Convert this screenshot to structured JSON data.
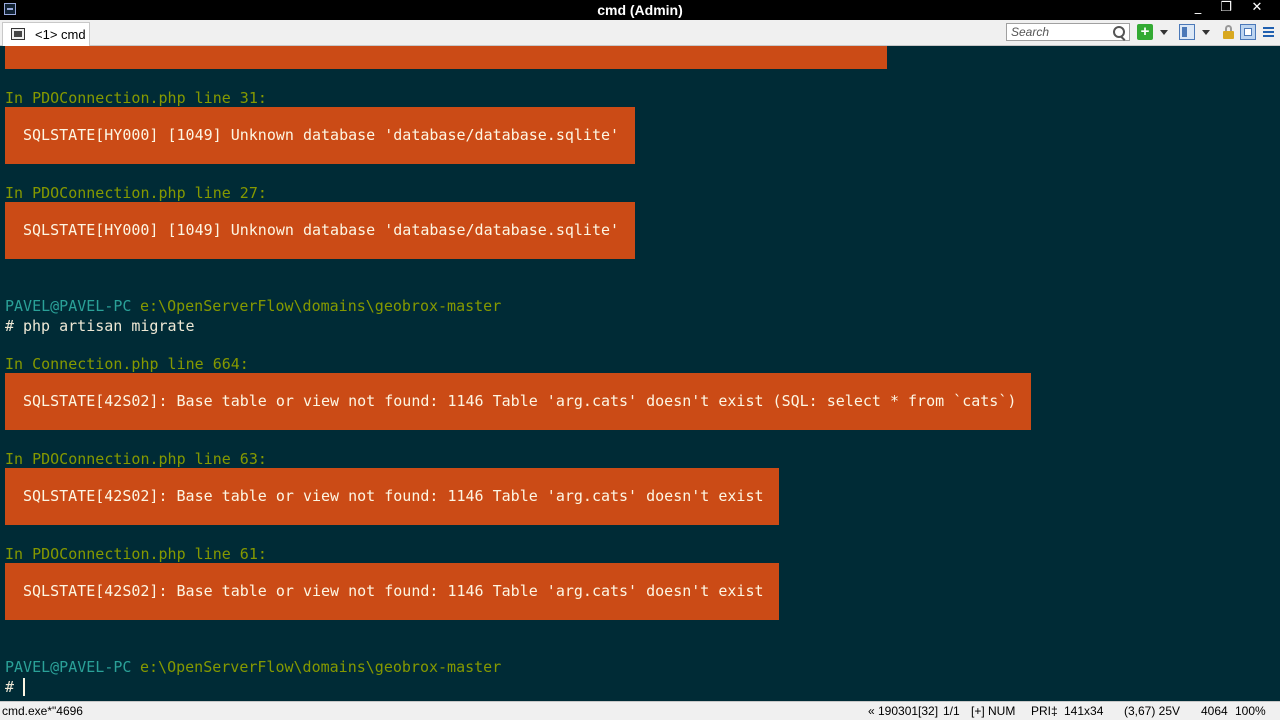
{
  "window": {
    "title": "cmd (Admin)",
    "minimize": "_",
    "restore": "❐",
    "close": "✕"
  },
  "toolbar": {
    "tab_label": "<1> cmd",
    "search_placeholder": "Search",
    "new_console": "+"
  },
  "console": {
    "lines": [
      "In PDOConnection.php line 31:",
      "In PDOConnection.php line 27:",
      "PAVEL@PAVEL-PC",
      "e:\\OpenServerFlow\\domains\\geobrox-master",
      "#",
      "php artisan migrate",
      "In Connection.php line 664:",
      "In PDOConnection.php line 63:",
      "In PDOConnection.php line 61:",
      "PAVEL@PAVEL-PC",
      "e:\\OpenServerFlow\\domains\\geobrox-master",
      "#"
    ],
    "errors": [
      "SQLSTATE[HY000] [1049] Unknown database 'database/database.sqlite'",
      "SQLSTATE[HY000] [1049] Unknown database 'database/database.sqlite'",
      "SQLSTATE[42S02]: Base table or view not found: 1146 Table 'arg.cats' doesn't exist (SQL: select * from `cats`)",
      "SQLSTATE[42S02]: Base table or view not found: 1146 Table 'arg.cats' doesn't exist",
      "SQLSTATE[42S02]: Base table or view not found: 1146 Table 'arg.cats' doesn't exist"
    ]
  },
  "status": {
    "process": "cmd.exe*\"4696",
    "position": "« 190301[32]",
    "console_index": "1/1",
    "flags": "[+] NUM",
    "priority": "PRI‡",
    "size": "141x34",
    "cursor": "(3,67) 25V",
    "chars": "4064",
    "zoom": "100%"
  },
  "colors": {
    "background": "#002b36",
    "error_box": "#cb4b16",
    "path_label": "#859900",
    "user_host": "#2aa198"
  }
}
